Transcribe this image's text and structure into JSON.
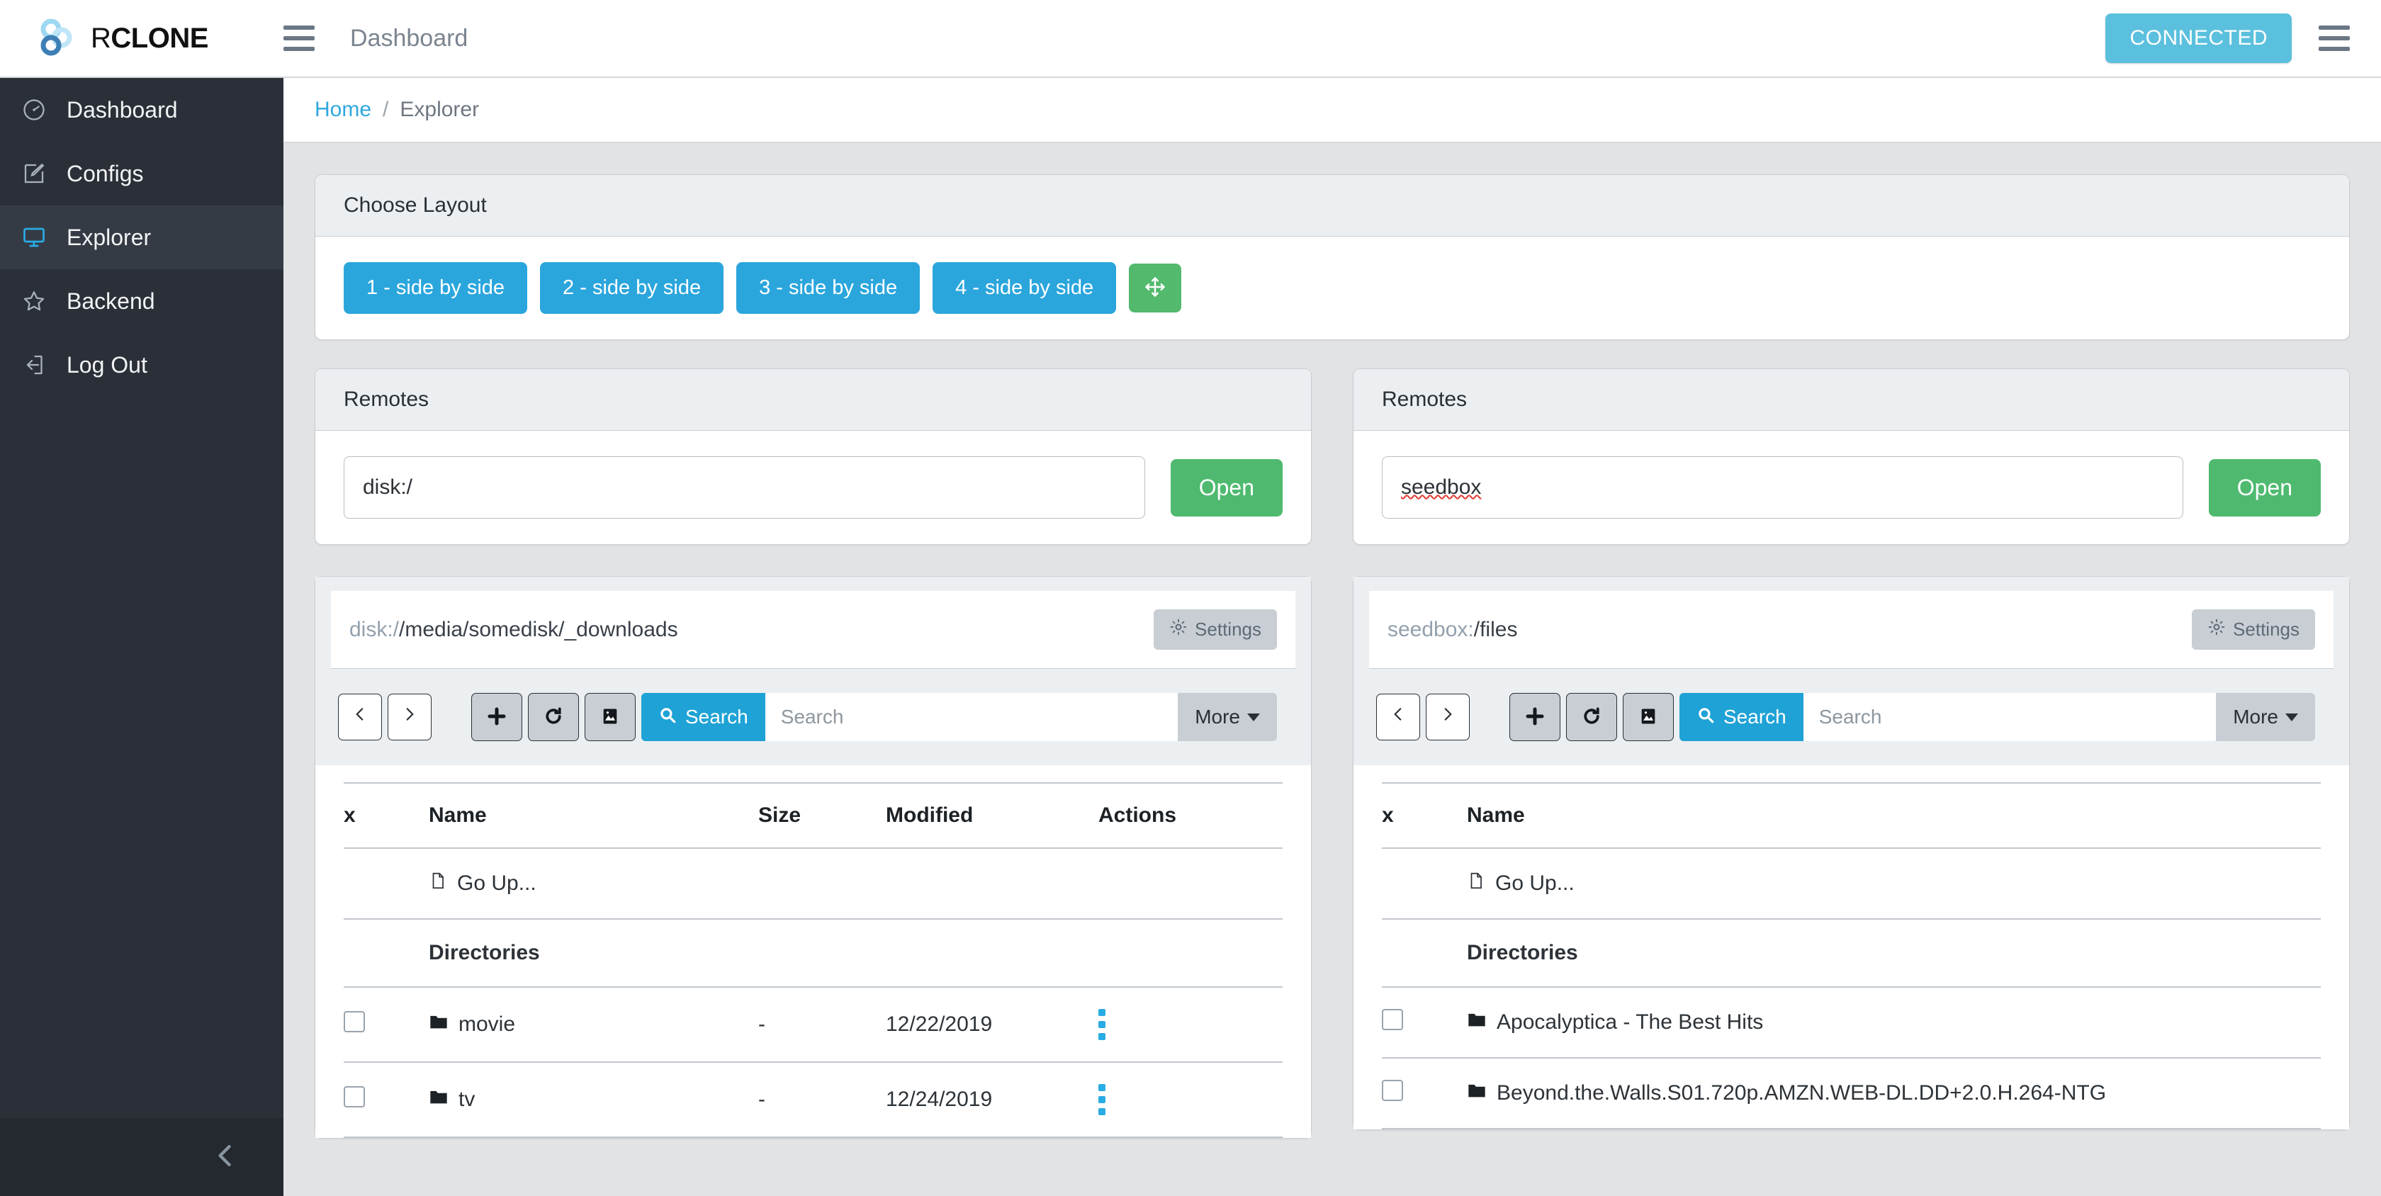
{
  "brand": {
    "r": "R",
    "clone": "CLONE",
    "logo_icon": "rclone-logo-icon"
  },
  "topnav": {
    "menu_icon": "hamburger-menu-icon",
    "title": "Dashboard",
    "connected_label": "CONNECTED",
    "right_menu_icon": "hamburger-menu-icon"
  },
  "sidebar": {
    "items": [
      {
        "label": "Dashboard",
        "icon": "gauge-icon",
        "active": false
      },
      {
        "label": "Configs",
        "icon": "edit-icon",
        "active": false
      },
      {
        "label": "Explorer",
        "icon": "monitor-icon",
        "active": true
      },
      {
        "label": "Backend",
        "icon": "star-icon",
        "active": false
      },
      {
        "label": "Log Out",
        "icon": "logout-icon",
        "active": false
      }
    ],
    "collapse_icon": "chevron-left-icon"
  },
  "breadcrumb": {
    "home": "Home",
    "separator": "/",
    "current": "Explorer"
  },
  "layout_card": {
    "title": "Choose Layout",
    "buttons": [
      "1 - side by side",
      "2 - side by side",
      "3 - side by side",
      "4 - side by side"
    ],
    "move_icon": "arrows-move-icon"
  },
  "colors": {
    "accent_blue": "#2ba6dd",
    "connected_blue": "#5bc0de",
    "green": "#4fba6f",
    "sidebar_bg": "#2b3038",
    "sidebar_active": "#353b45",
    "body_bg": "#e2e3e5",
    "card_head": "#eceff1",
    "dots_blue": "#29ace3"
  },
  "panels": [
    {
      "remotes_title": "Remotes",
      "remote_value": "disk:/",
      "remote_misspelled": false,
      "open_label": "Open",
      "path_prefix": "disk:/",
      "path_rest": "/media/somedisk/_downloads",
      "settings_label": "Settings",
      "settings_icon": "gear-icon",
      "back_icon": "chevron-left-icon",
      "forward_icon": "chevron-right-icon",
      "tools": [
        {
          "icon": "plus-icon",
          "name": "new-folder-button"
        },
        {
          "icon": "refresh-icon",
          "name": "refresh-button"
        },
        {
          "icon": "image-icon",
          "name": "thumbnails-button"
        }
      ],
      "search_label": "Search",
      "search_icon": "search-icon",
      "search_value": "",
      "search_placeholder": "Search",
      "more_label": "More",
      "columns": [
        "x",
        "Name",
        "Size",
        "Modified",
        "Actions"
      ],
      "go_up_label": "Go Up...",
      "go_up_icon": "file-icon",
      "directories_label": "Directories",
      "rows": [
        {
          "name": "movie",
          "size": "-",
          "modified": "12/22/2019",
          "icon": "folder-icon"
        },
        {
          "name": "tv",
          "size": "-",
          "modified": "12/24/2019",
          "icon": "folder-icon"
        }
      ]
    },
    {
      "remotes_title": "Remotes",
      "remote_value": "seedbox",
      "remote_misspelled": true,
      "open_label": "Open",
      "path_prefix": "seedbox:",
      "path_rest": "/files",
      "settings_label": "Settings",
      "settings_icon": "gear-icon",
      "back_icon": "chevron-left-icon",
      "forward_icon": "chevron-right-icon",
      "tools": [
        {
          "icon": "plus-icon",
          "name": "new-folder-button"
        },
        {
          "icon": "refresh-icon",
          "name": "refresh-button"
        },
        {
          "icon": "image-icon",
          "name": "thumbnails-button"
        }
      ],
      "search_label": "Search",
      "search_icon": "search-icon",
      "search_value": "",
      "search_placeholder": "Search",
      "more_label": "More",
      "columns": [
        "x",
        "Name"
      ],
      "go_up_label": "Go Up...",
      "go_up_icon": "file-icon",
      "directories_label": "Directories",
      "rows": [
        {
          "name": "Apocalyptica - The Best Hits",
          "icon": "folder-icon"
        },
        {
          "name": "Beyond.the.Walls.S01.720p.AMZN.WEB-DL.DD+2.0.H.264-NTG",
          "icon": "folder-icon"
        }
      ]
    }
  ]
}
